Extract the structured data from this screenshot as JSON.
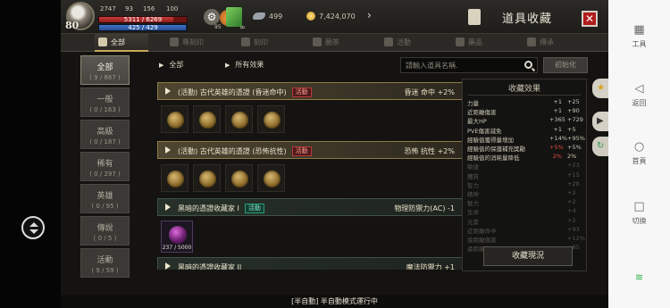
{
  "player": {
    "level": "80",
    "stats": [
      "2747",
      "93",
      "156",
      "100"
    ],
    "hp_text": "5311 / 6269",
    "hp_fraction": 0.847,
    "mp_text": "425 / 429",
    "mp_fraction": 0.99,
    "wing_count": "499",
    "gold": "7,424,070",
    "leaf_badge": "∞",
    "gear_badge": "95"
  },
  "window": {
    "title": "道具收藏",
    "close_icon": "close-icon"
  },
  "tabs": [
    "全部",
    "專刻印",
    "刻印",
    "願茶",
    "活動",
    "藥品",
    "傳承"
  ],
  "categories": [
    {
      "name": "全部",
      "count": "( 9 / 867 )"
    },
    {
      "name": "一般",
      "count": "( 0 / 163 )"
    },
    {
      "name": "高級",
      "count": "( 0 / 187 )"
    },
    {
      "name": "稀有",
      "count": "( 0 / 297 )"
    },
    {
      "name": "英雄",
      "count": "( 0 / 95 )"
    },
    {
      "name": "傳說",
      "count": "( 0 / 5 )"
    },
    {
      "name": "活動",
      "count": "( 9 / 59 )"
    }
  ],
  "breadcrumb": [
    "全部",
    "所有效果"
  ],
  "search": {
    "placeholder": "請輸入道具名稱."
  },
  "reset_label": "初始化",
  "groups": [
    {
      "name": "(活動) 古代英雄的憑證 (昏迷命中)",
      "badge": "活動",
      "effect": "昏迷 命中 +2%"
    },
    {
      "name": "(活動) 古代英雄的憑證 (恐怖抗性)",
      "badge": "活動",
      "effect": "恐怖 抗性 +2%"
    },
    {
      "name": "黑暗的憑證收藏家 I",
      "badge": "活動",
      "effect": "物理防禦力(AC) -1",
      "item_qty": "237 / 5000"
    },
    {
      "name": "黑暗的憑證收藏家 II",
      "effect": "魔法防禦力 +1"
    }
  ],
  "effects": {
    "title": "收藏效果",
    "rows": [
      {
        "name": "力量",
        "a": "+1",
        "b": "+25",
        "dim": false
      },
      {
        "name": "近距離傷害",
        "a": "+1",
        "b": "+90",
        "dim": false
      },
      {
        "name": "最大HP",
        "a": "+365",
        "b": "+729",
        "dim": false
      },
      {
        "name": "PVE傷害減免",
        "a": "+1",
        "b": "+5",
        "dim": false
      },
      {
        "name": "經驗值獲得量增加",
        "a": "+14%",
        "b": "+95%",
        "dim": false
      },
      {
        "name": "經驗值的保護補充獎勵",
        "a": "+5%",
        "b": "+5%",
        "dim": false,
        "a_red": true
      },
      {
        "name": "經驗值的消耗量降低",
        "a": "2%",
        "b": "2%",
        "dim": false,
        "a_red": true
      },
      {
        "name": "敏捷",
        "a": "",
        "b": "+23",
        "dim": true
      },
      {
        "name": "體質",
        "a": "",
        "b": "+15",
        "dim": true
      },
      {
        "name": "智力",
        "a": "",
        "b": "+28",
        "dim": true
      },
      {
        "name": "精神",
        "a": "",
        "b": "+2",
        "dim": true
      },
      {
        "name": "魅力",
        "a": "",
        "b": "+2",
        "dim": true
      },
      {
        "name": "生命",
        "a": "",
        "b": "+4",
        "dim": true
      },
      {
        "name": "元素",
        "a": "",
        "b": "+2",
        "dim": true
      },
      {
        "name": "近距離命中",
        "a": "",
        "b": "+93",
        "dim": true
      },
      {
        "name": "遠距離傷害",
        "a": "",
        "b": "+12%",
        "dim": true
      },
      {
        "name": "遠距離傷害",
        "a": "",
        "b": "+85",
        "dim": true
      }
    ],
    "button": "收藏現況"
  },
  "status_text": "[半自動] 半自動模式運行中",
  "android_side": [
    {
      "label": "工具",
      "icon": "grid-icon"
    },
    {
      "label": "返回",
      "icon": "back-triangle-icon"
    },
    {
      "label": "首頁",
      "icon": "home-circle-icon"
    },
    {
      "label": "切換",
      "icon": "square-icon"
    }
  ]
}
